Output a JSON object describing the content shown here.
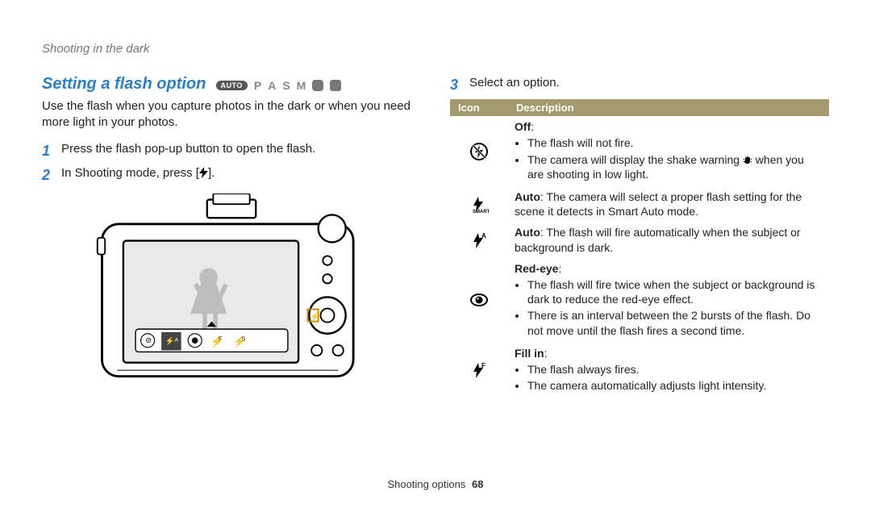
{
  "breadcrumb": "Shooting in the dark",
  "section_title": "Setting a flash option",
  "mode_labels": {
    "auto": "AUTO",
    "p": "P",
    "a": "A",
    "s": "S",
    "m": "M"
  },
  "intro": "Use the flash when you capture photos in the dark or when you need more light in your photos.",
  "steps": {
    "s1_num": "1",
    "s1_text": "Press the flash pop-up button to open the flash.",
    "s2_num": "2",
    "s2_pre": "In Shooting mode, press [",
    "s2_post": "].",
    "s3_num": "3",
    "s3_text": "Select an option."
  },
  "table": {
    "head_icon": "Icon",
    "head_desc": "Description",
    "off": {
      "title": "Off",
      "b1": "The flash will not fire.",
      "b2_pre": "The camera will display the shake warning ",
      "b2_post": " when you are shooting in low light."
    },
    "smart": {
      "title": "Auto",
      "text": ": The camera will select a proper flash setting for the scene it detects in Smart Auto mode."
    },
    "autoA": {
      "title": "Auto",
      "text": ": The flash will fire automatically when the subject or background is dark."
    },
    "redeye": {
      "title": "Red-eye",
      "b1": "The flash will fire twice when the subject or background is dark to reduce the red-eye effect.",
      "b2": "There is an interval between the 2 bursts of the flash. Do not move until the flash fires a second time."
    },
    "fillin": {
      "title": "Fill in",
      "b1": "The flash always fires.",
      "b2": "The camera automatically adjusts light intensity."
    }
  },
  "footer": {
    "section": "Shooting options",
    "page": "68"
  }
}
